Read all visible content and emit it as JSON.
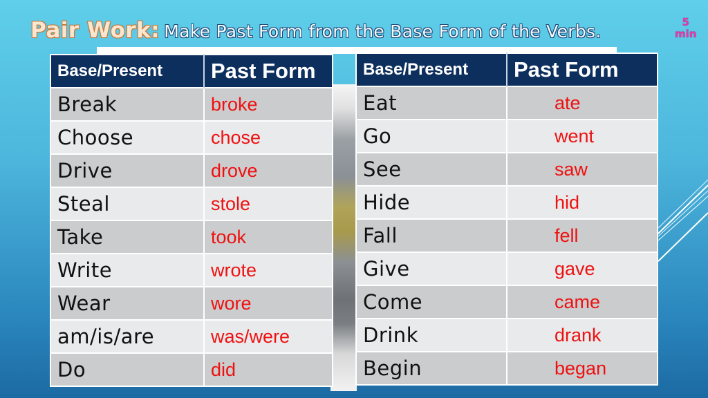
{
  "title": {
    "lead": "Pair Work:",
    "rest": "Make Past Form from the Base Form of the Verbs."
  },
  "timer": {
    "number": "5",
    "unit": "min"
  },
  "colors": {
    "header_bg": "#0d2f5e",
    "answer_text": "#ee1111",
    "row_dark": "#cbcccd",
    "row_light": "#e9eaeb",
    "timer": "#e23aa8"
  },
  "tables": [
    {
      "headers": [
        "Base/Present",
        "Past Form"
      ],
      "rows": [
        {
          "base": "Break",
          "past": "broke"
        },
        {
          "base": "Choose",
          "past": "chose"
        },
        {
          "base": "Drive",
          "past": "drove"
        },
        {
          "base": "Steal",
          "past": "stole"
        },
        {
          "base": "Take",
          "past": "took"
        },
        {
          "base": "Write",
          "past": "wrote"
        },
        {
          "base": "Wear",
          "past": "wore"
        },
        {
          "base": "am/is/are",
          "past": "was/were"
        },
        {
          "base": "Do",
          "past": "did"
        }
      ]
    },
    {
      "headers": [
        "Base/Present",
        "Past Form"
      ],
      "rows": [
        {
          "base": "Eat",
          "past": "ate"
        },
        {
          "base": "Go",
          "past": "went"
        },
        {
          "base": "See",
          "past": "saw"
        },
        {
          "base": "Hide",
          "past": "hid"
        },
        {
          "base": "Fall",
          "past": "fell"
        },
        {
          "base": "Give",
          "past": "gave"
        },
        {
          "base": "Come",
          "past": "came"
        },
        {
          "base": "Drink",
          "past": "drank"
        },
        {
          "base": "Begin",
          "past": "began"
        }
      ]
    }
  ]
}
